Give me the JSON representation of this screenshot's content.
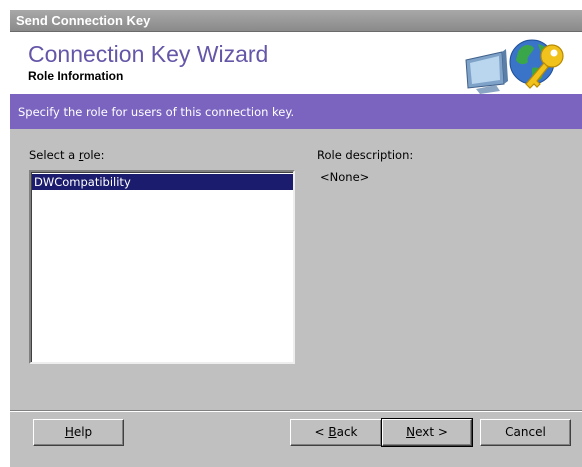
{
  "window": {
    "title": "Send Connection Key"
  },
  "header": {
    "title": "Connection Key Wizard",
    "subtitle": "Role Information",
    "graphic_icons": [
      "monitor-icon",
      "globe-icon",
      "key-icon"
    ]
  },
  "banner": {
    "text": "Specify the role for users of this connection key."
  },
  "role_select": {
    "label_prefix": "Select a ",
    "label_accel": "r",
    "label_suffix": "ole:",
    "items": [
      "DWCompatibility"
    ],
    "selected_index": 0
  },
  "role_description": {
    "label": "Role description:",
    "value": "<None>"
  },
  "buttons": {
    "help_accel": "H",
    "help_rest": "elp",
    "back_prefix": "< ",
    "back_accel": "B",
    "back_rest": "ack",
    "next_accel": "N",
    "next_rest": "ext >",
    "cancel": "Cancel"
  },
  "colors": {
    "title_accent": "#6656a8",
    "banner": "#7a64c0",
    "selection": "#1c1c6e",
    "dialog_bg": "#c0c0c0"
  }
}
